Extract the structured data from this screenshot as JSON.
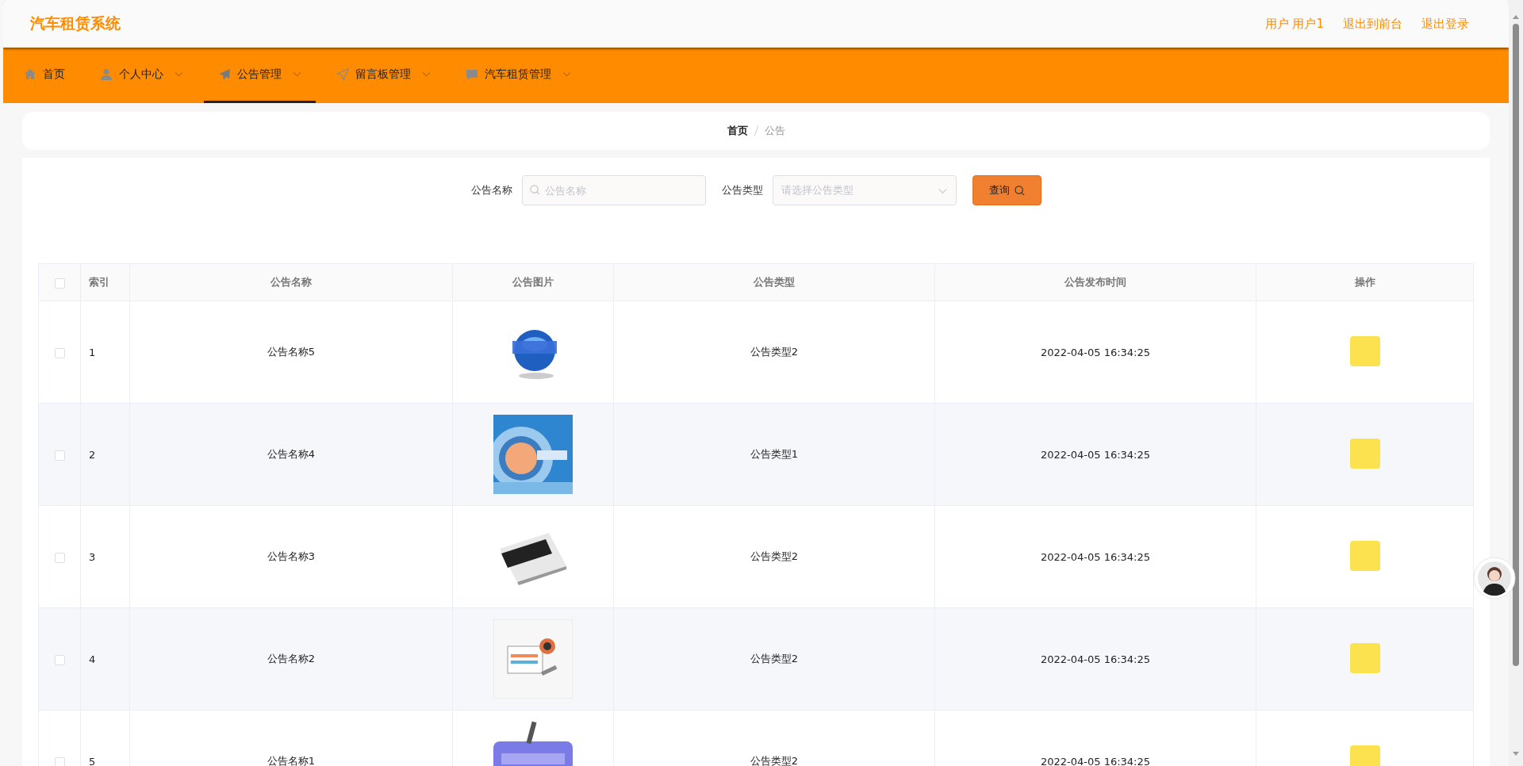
{
  "app": {
    "title": "汽车租赁系统"
  },
  "user_links": [
    "用户 用户1",
    "退出到前台",
    "退出登录"
  ],
  "nav": [
    {
      "label": "首页",
      "selected": false,
      "dropdown": false
    },
    {
      "label": "个人中心",
      "selected": false,
      "dropdown": true
    },
    {
      "label": "公告管理",
      "selected": true,
      "dropdown": true
    },
    {
      "label": "留言板管理",
      "selected": false,
      "dropdown": true
    },
    {
      "label": "汽车租赁管理",
      "selected": false,
      "dropdown": true
    }
  ],
  "breadcrumb": [
    "首页",
    "公告"
  ],
  "search": {
    "fields": [
      {
        "kind": "text",
        "label": "公告名称",
        "placeholder": "公告名称"
      },
      {
        "kind": "select",
        "label": "公告类型",
        "placeholder": "请选择公告类型"
      }
    ],
    "button": "查询"
  },
  "table": {
    "all_checked": false,
    "columns": [
      "索引",
      "公告名称",
      "公告图片",
      "公告类型",
      "公告发布时间",
      "操作"
    ],
    "rows": [
      {
        "checked": false,
        "index": "1",
        "name": "公告名称5",
        "type": "公告类型2",
        "time": "2022-04-05 16:34:25"
      },
      {
        "checked": false,
        "index": "2",
        "name": "公告名称4",
        "type": "公告类型1",
        "time": "2022-04-05 16:34:25"
      },
      {
        "checked": false,
        "index": "3",
        "name": "公告名称3",
        "type": "公告类型2",
        "time": "2022-04-05 16:34:25"
      },
      {
        "checked": false,
        "index": "4",
        "name": "公告名称2",
        "type": "公告类型2",
        "time": "2022-04-05 16:34:25"
      },
      {
        "checked": false,
        "index": "5",
        "name": "公告名称1",
        "type": "公告类型2",
        "time": "2022-04-05 16:34:25"
      }
    ]
  }
}
